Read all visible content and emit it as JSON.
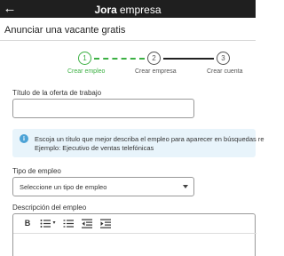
{
  "topbar": {
    "logo": "Jora",
    "logo_suffix": "empresa",
    "back_icon": "arrow-left-icon"
  },
  "page": {
    "title": "Anunciar una vacante gratis"
  },
  "stepper": {
    "steps": [
      {
        "number": "1",
        "label": "Crear empleo",
        "state": "active"
      },
      {
        "number": "2",
        "label": "Crear empresa",
        "state": "pending"
      },
      {
        "number": "3",
        "label": "Crear cuenta",
        "state": "pending"
      }
    ],
    "colors": {
      "active": "#3cb043",
      "pending": "#555555"
    }
  },
  "form": {
    "job_title": {
      "label": "Título de la oferta de trabajo",
      "value": ""
    },
    "info": {
      "icon": "info-icon",
      "line1": "Escoja un título que mejor describa el empleo para aparecer en búsquedas re",
      "line2": "Ejemplo: Ejecutivo de ventas telefónicas"
    },
    "job_type": {
      "label": "Tipo de empleo",
      "selected": "Seleccione un tipo de empleo"
    },
    "description": {
      "label": "Descripción del empleo",
      "toolbar": {
        "bold": "B",
        "bullets_icon": "bulleted-list-icon",
        "numbered_icon": "numbered-list-icon",
        "outdent_icon": "outdent-icon",
        "indent_icon": "indent-icon"
      }
    }
  }
}
